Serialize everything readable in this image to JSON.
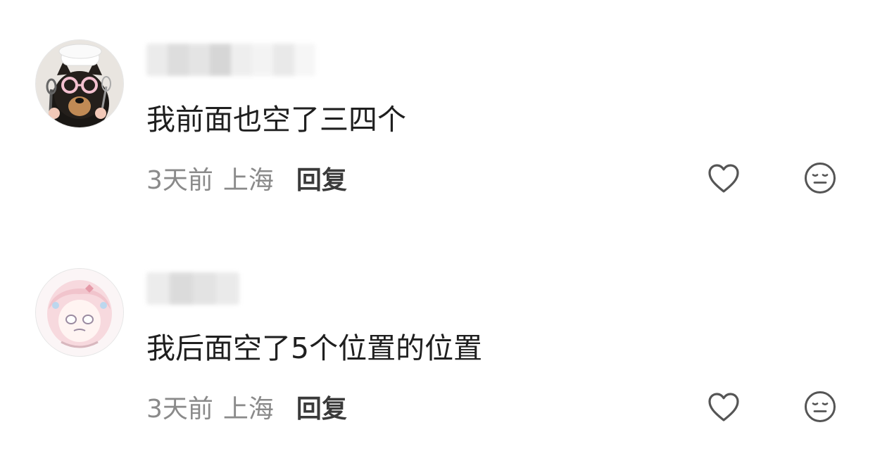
{
  "comments": [
    {
      "avatar": "chef-dog-avatar",
      "username_obscured": true,
      "text": "我前面也空了三四个",
      "time": "3天前",
      "location": "上海",
      "reply_label": "回复",
      "like_icon": "heart-outline-icon",
      "dislike_icon": "neutral-face-icon"
    },
    {
      "avatar": "anime-girl-avatar",
      "username_obscured": true,
      "text": "我后面空了5个位置的位置",
      "time": "3天前",
      "location": "上海",
      "reply_label": "回复",
      "like_icon": "heart-outline-icon",
      "dislike_icon": "neutral-face-icon"
    }
  ],
  "colors": {
    "text_primary": "#1f1f1f",
    "text_secondary": "#8a8a8a",
    "reply": "#3a3a3a",
    "icon": "#555555"
  }
}
